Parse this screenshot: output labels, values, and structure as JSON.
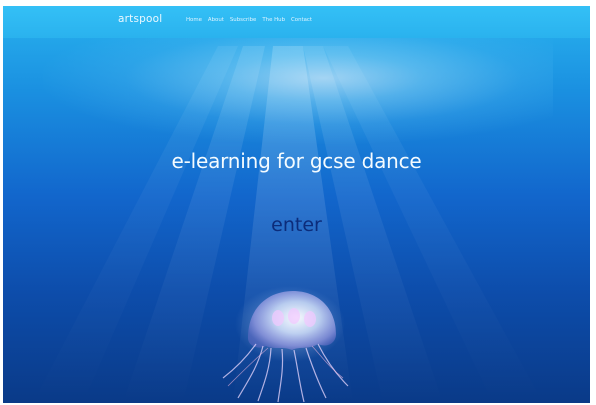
{
  "site": {
    "brand": "artspool"
  },
  "nav": {
    "items": [
      "Home",
      "About",
      "Subscribe",
      "The Hub",
      "Contact"
    ]
  },
  "hero": {
    "headline": "e-learning for gcse dance",
    "enter_label": "enter"
  },
  "colors": {
    "navbar": "#2ab2ee",
    "headline": "#f4fbff",
    "enter": "#0c2c7a",
    "deep_water": "#0a3a88"
  },
  "icons": {
    "hero_image": "jellyfish-illustration"
  }
}
